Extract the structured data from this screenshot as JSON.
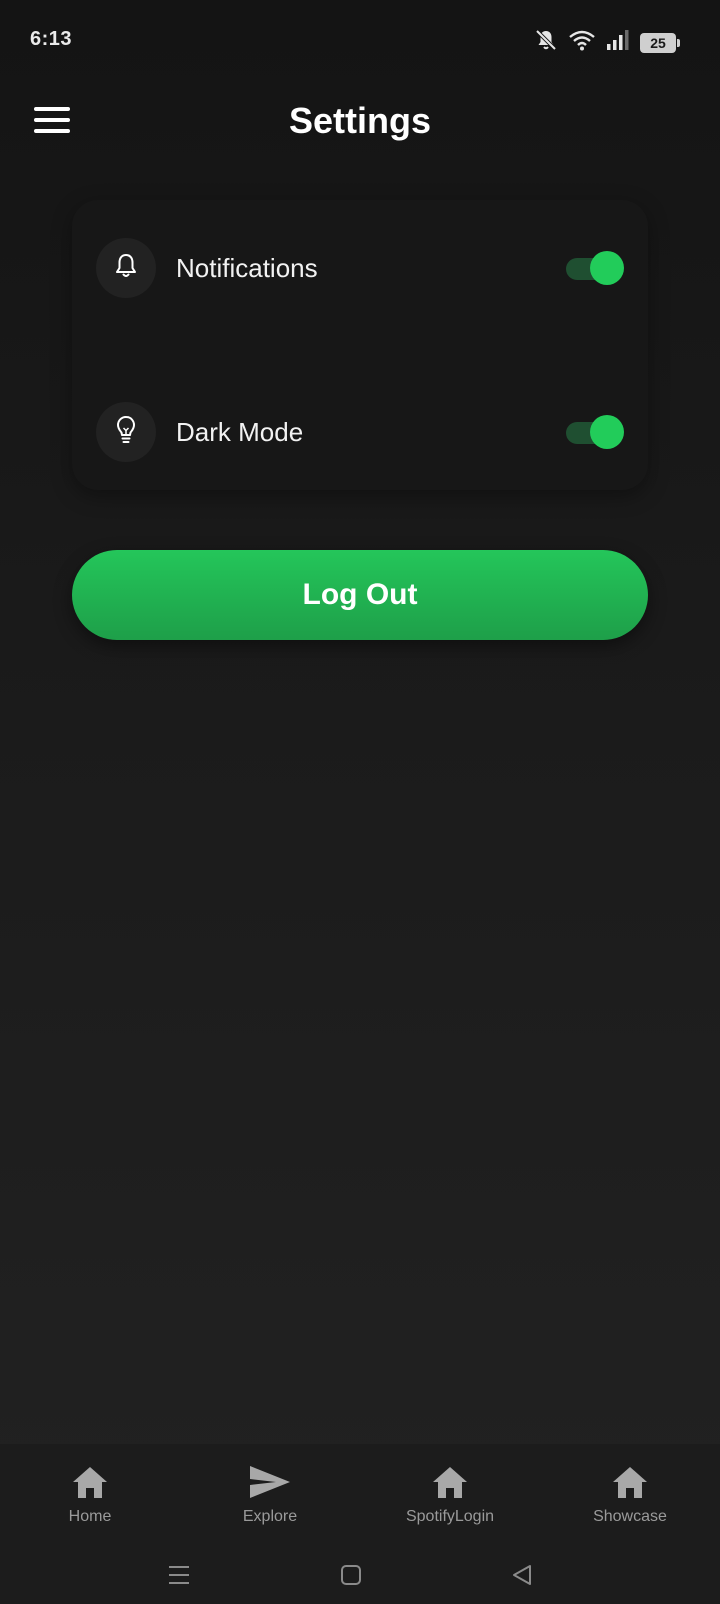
{
  "status_bar": {
    "time": "6:13",
    "battery": "25",
    "icons": [
      "muted-bell-icon",
      "wifi-icon",
      "signal-icon",
      "battery-icon"
    ]
  },
  "header": {
    "title": "Settings",
    "menu_icon": "hamburger-menu-icon"
  },
  "settings": {
    "items": [
      {
        "label": "Notifications",
        "icon": "bell-icon",
        "enabled": true
      },
      {
        "label": "Dark Mode",
        "icon": "lightbulb-icon",
        "enabled": true
      }
    ]
  },
  "logout": {
    "label": "Log Out"
  },
  "bottom_nav": {
    "items": [
      {
        "label": "Home",
        "icon": "home-icon"
      },
      {
        "label": "Explore",
        "icon": "send-icon"
      },
      {
        "label": "SpotifyLogin",
        "icon": "home-icon"
      },
      {
        "label": "Showcase",
        "icon": "home-icon"
      }
    ]
  },
  "colors": {
    "accent": "#22cc5a",
    "background": "#141414",
    "card": "#171717",
    "nav_label": "#9a9a9a"
  }
}
